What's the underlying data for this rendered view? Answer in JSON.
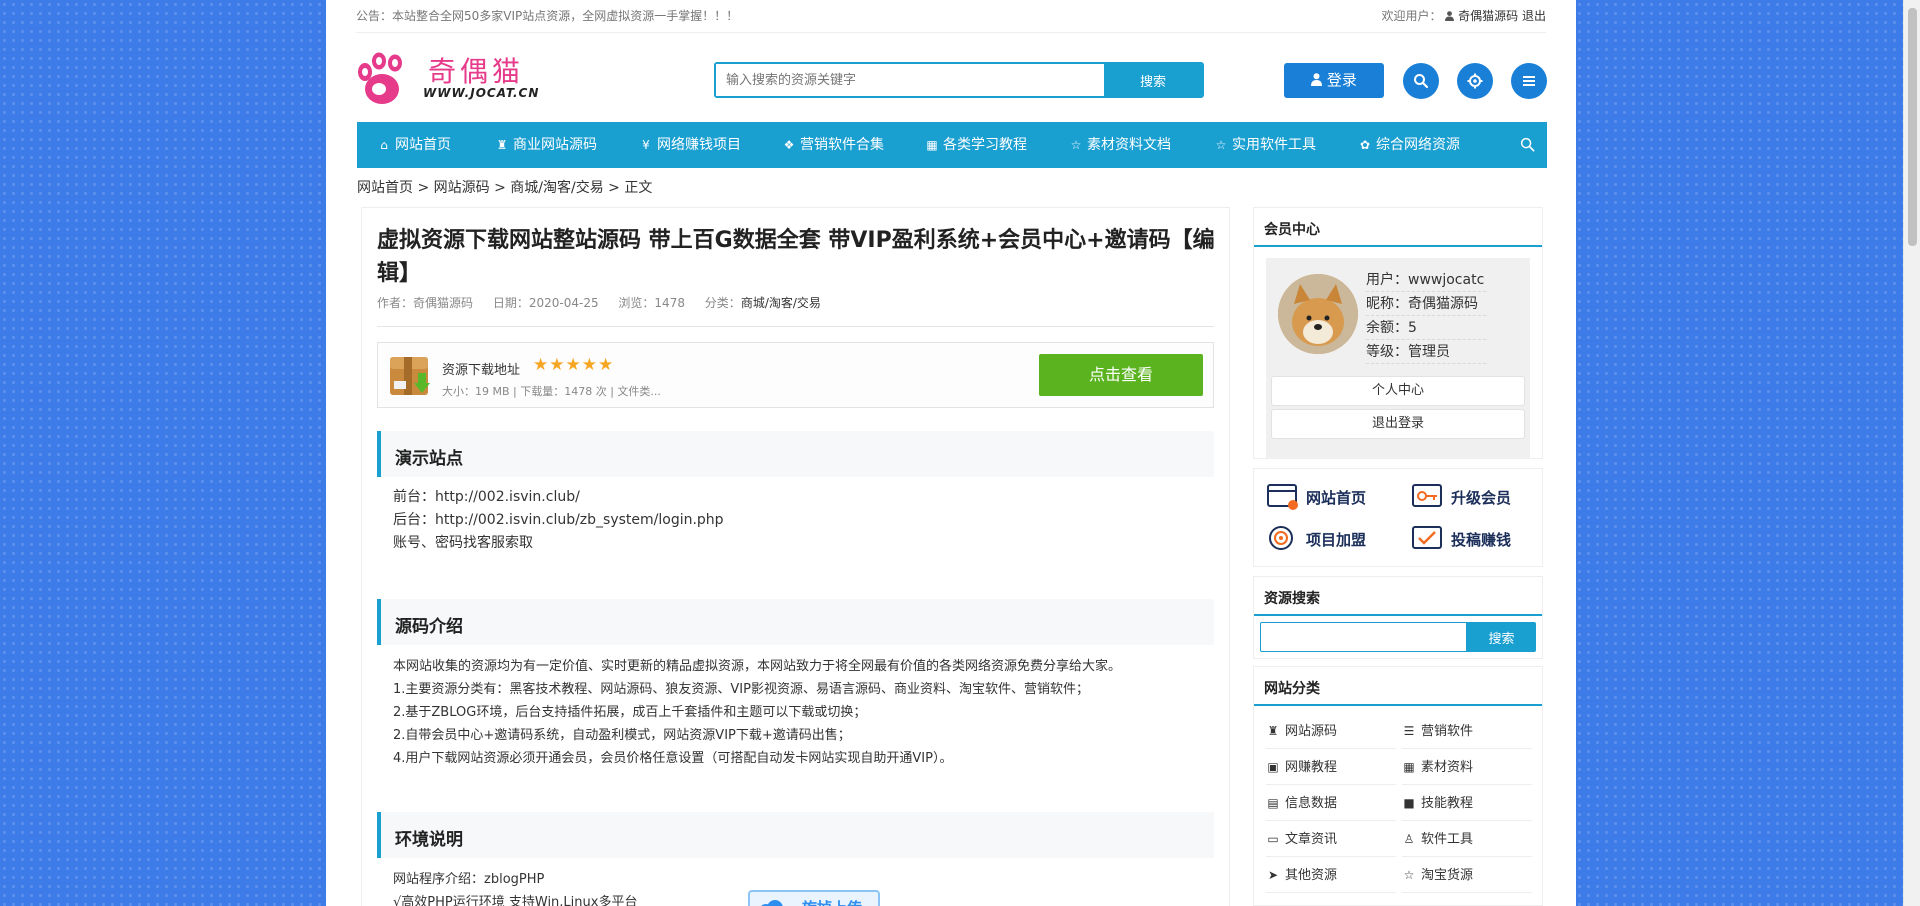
{
  "topbar": {
    "notice": "公告：本站整合全网50多家VIP站点资源，全网虚拟资源一手掌握！！！",
    "welcome_prefix": "欢迎用户：",
    "username": "奇偶猫源码",
    "logout": "退出"
  },
  "header": {
    "site_name": "奇偶猫",
    "site_url": "WWW.JOCAT.CN",
    "search_placeholder": "输入搜索的资源关键字",
    "search_button": "搜索",
    "login_label": "登录"
  },
  "nav": {
    "items": [
      {
        "icon": "home-icon",
        "label": "网站首页"
      },
      {
        "icon": "gift-icon",
        "label": "商业网站源码"
      },
      {
        "icon": "yen-icon",
        "label": "网络赚钱项目"
      },
      {
        "icon": "dropbox-icon",
        "label": "营销软件合集"
      },
      {
        "icon": "film-icon",
        "label": "各类学习教程"
      },
      {
        "icon": "star-icon",
        "label": "素材资料文档"
      },
      {
        "icon": "star-icon",
        "label": "实用软件工具"
      },
      {
        "icon": "cubes-icon",
        "label": "综合网络资源"
      }
    ]
  },
  "breadcrumb": {
    "home": "网站首页",
    "sep": ">",
    "cat1": "网站源码",
    "cat2": "商城/淘客/交易",
    "current": "正文"
  },
  "article": {
    "title": "虚拟资源下载网站整站源码 带上百G数据全套 带VIP盈利系统+会员中心+邀请码【编辑】",
    "meta": {
      "author": "作者：奇偶猫源码",
      "date": "日期：2020-04-25",
      "views": "浏览：1478",
      "category_label": "分类：",
      "category": "商城/淘客/交易"
    },
    "download": {
      "title": "资源下载地址",
      "stars": "★★★★★",
      "info": "大小：19 MB | 下载量：1478 次 | 文件类...",
      "button": "点击查看"
    },
    "sections": {
      "demo": {
        "title": "演示站点",
        "lines": [
          "前台：http://002.isvin.club/",
          "后台：http://002.isvin.club/zb_system/login.php",
          "账号、密码找客服索取"
        ]
      },
      "intro": {
        "title": "源码介绍",
        "lines": [
          "本网站收集的资源均为有一定价值、实时更新的精品虚拟资源，本网站致力于将全网最有价值的各类网络资源免费分享给大家。",
          "1.主要资源分类有：黑客技术教程、网站源码、狼友资源、VIP影视资源、易语言源码、商业资料、淘宝软件、营销软件；",
          "2.基于ZBLOG环境，后台支持插件拓展，成百上千套插件和主题可以下载或切换；",
          "2.自带会员中心+邀请码系统，自动盈利模式，网站资源VIP下载+邀请码出售；",
          "4.用户下载网站资源必须开通会员，会员价格任意设置（可搭配自动发卡网站实现自助开通VIP）。"
        ]
      },
      "env": {
        "title": "环境说明",
        "lines": [
          "网站程序介绍：zblogPHP",
          "√高效PHP运行环境 支持Win,Linux多平台"
        ]
      }
    },
    "upload_badge": "旋掉上传"
  },
  "sidebar": {
    "member": {
      "title": "会员中心",
      "rows": [
        "用户：wwwjocatc",
        "昵称：奇偶猫源码",
        "余额：5",
        "等级：管理员"
      ],
      "center_button": "个人中心",
      "logout_button": "退出登录"
    },
    "quick": [
      "网站首页",
      "升级会员",
      "项目加盟",
      "投稿赚钱"
    ],
    "search": {
      "title": "资源搜索",
      "button": "搜索"
    },
    "categories": {
      "title": "网站分类",
      "items": [
        {
          "icon": "gift-icon",
          "label": "网站源码"
        },
        {
          "icon": "server-icon",
          "label": "营销软件"
        },
        {
          "icon": "money-icon",
          "label": "网赚教程"
        },
        {
          "icon": "grid-icon",
          "label": "素材资料"
        },
        {
          "icon": "film-icon",
          "label": "信息数据"
        },
        {
          "icon": "video-icon",
          "label": "技能教程"
        },
        {
          "icon": "newspaper-icon",
          "label": "文章资讯"
        },
        {
          "icon": "bag-icon",
          "label": "软件工具"
        },
        {
          "icon": "send-icon",
          "label": "其他资源"
        },
        {
          "icon": "star-icon",
          "label": "淘宝货源"
        }
      ]
    }
  },
  "colors": {
    "primary": "#1a9fd1",
    "login": "#1a7fd6",
    "view_button": "#5bb31f",
    "background": "#3d7be8"
  }
}
